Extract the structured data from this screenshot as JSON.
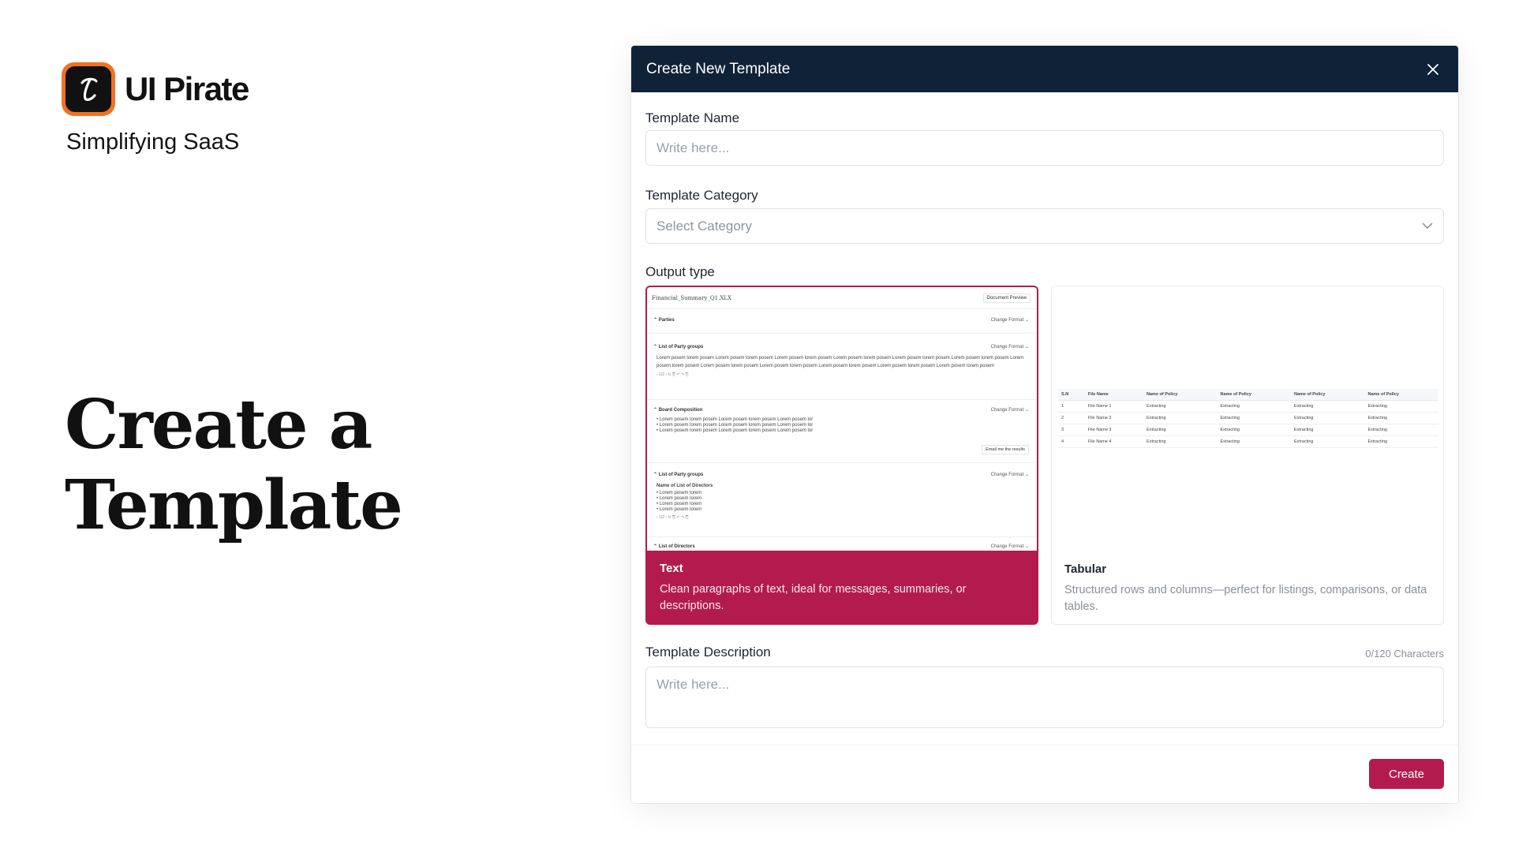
{
  "brand": {
    "name": "UI Pirate",
    "tagline": "Simplifying SaaS",
    "logo_letter": "t",
    "accent": "#f07222"
  },
  "hero": {
    "line1": "Create a",
    "line2": "Template"
  },
  "modal": {
    "title": "Create New Template",
    "header_color": "#0f2238",
    "template_name": {
      "label": "Template Name",
      "placeholder": "Write here..."
    },
    "template_category": {
      "label": "Template Category",
      "placeholder": "Select Category"
    },
    "output_type": {
      "label": "Output type",
      "selected": "Text",
      "options": [
        {
          "title": "Text",
          "description": "Clean paragraphs of text, ideal for messages, summaries, or descriptions."
        },
        {
          "title": "Tabular",
          "description": "Structured rows and columns—perfect for listings, comparisons, or data tables."
        }
      ]
    },
    "text_preview": {
      "file": "Financial_Summary_Q1.XLX",
      "doc_button": "Document Preview",
      "change_format": "Change Format",
      "sections": [
        "Parties",
        "List of Party groups",
        "Board Composition",
        "List of Party groups",
        "List of Directors"
      ],
      "paragraph": "Lorem posem lorem posem Lorem posem lorem posem Lorem posem lorem posem Lorem posem lorem posem Lorem posem lorem posem Lorem posem lorem posem Lorem posem lorem posem Lorem posem lorem posem Lorem posem lorem posem Lorem posem lorem posem Lorem posem lorem posem Lorem posem lorem posem",
      "board_bullets": [
        "Lorem posem lorem posem Lorem posem lorem posem Lorem posem lor",
        "Lorem posem lorem posem Lorem posem lorem posem Lorem posem lor",
        "Lorem posem lorem posem Lorem posem lorem posem Lorem posem lor"
      ],
      "email_button": "Email me the results",
      "directors_heading": "Name of List of Directors",
      "director_bullets": [
        "Lorem posem lorem",
        "Lorem posem lorem",
        "Lorem posem lorem",
        "Lorem posem lorem"
      ],
      "mini_toolbar": "‹ 1/2 › ↻ ⎘ ↶ ↷ ⎘"
    },
    "tabular_preview": {
      "headers": [
        "S.N",
        "File Name",
        "Name of Policy",
        "Name of Policy",
        "Name of Policy",
        "Name of Policy"
      ],
      "rows": [
        [
          "1",
          "File Name 1",
          "Extracting",
          "Extracting",
          "Extracting",
          "Extracting"
        ],
        [
          "2",
          "File Name 2",
          "Extracting",
          "Extracting",
          "Extracting",
          "Extracting"
        ],
        [
          "3",
          "File Name 3",
          "Extracting",
          "Extracting",
          "Extracting",
          "Extracting"
        ],
        [
          "4",
          "File Name 4",
          "Extracting",
          "Extracting",
          "Extracting",
          "Extracting"
        ]
      ]
    },
    "template_description": {
      "label": "Template Description",
      "placeholder": "Write here...",
      "char_count": "0/120 Characters"
    },
    "create_button": "Create",
    "accent": "#b31b4f"
  }
}
